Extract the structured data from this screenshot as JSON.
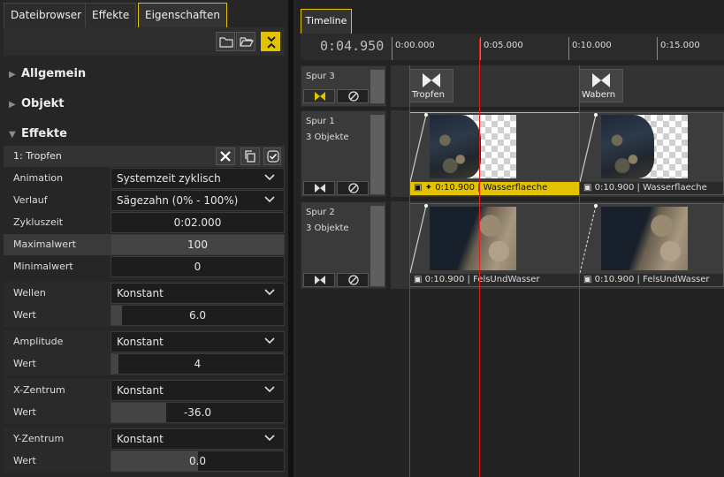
{
  "tabs": [
    {
      "label": "Dateibrowser",
      "active": false
    },
    {
      "label": "Effekte",
      "active": false
    },
    {
      "label": "Eigenschaften",
      "active": true
    }
  ],
  "toolbar_icons": [
    "folder-icon",
    "folder-open-icon",
    "collapse-icon"
  ],
  "sections": {
    "allgemein": "Allgemein",
    "objekt": "Objekt",
    "effekte": "Effekte"
  },
  "effect": {
    "title": "1: Tropfen",
    "rows": {
      "animation": {
        "label": "Animation",
        "value": "Systemzeit zyklisch"
      },
      "verlauf": {
        "label": "Verlauf",
        "value": "Sägezahn (0% - 100%)"
      },
      "zykluszeit": {
        "label": "Zykluszeit",
        "value": "0:02.000"
      },
      "maximalwert": {
        "label": "Maximalwert",
        "value": "100",
        "fill": 1.0
      },
      "minimalwert": {
        "label": "Minimalwert",
        "value": "0",
        "fill": 0.0
      }
    },
    "params": {
      "wellen": {
        "label": "Wellen",
        "mode": "Konstant",
        "wert_label": "Wert",
        "value": "6.0",
        "fill": 0.06
      },
      "amplitude": {
        "label": "Amplitude",
        "mode": "Konstant",
        "wert_label": "Wert",
        "value": "4",
        "fill": 0.04
      },
      "xzentrum": {
        "label": "X-Zentrum",
        "mode": "Konstant",
        "wert_label": "Wert",
        "value": "-36.0",
        "fill": 0.32
      },
      "yzentrum": {
        "label": "Y-Zentrum",
        "mode": "Konstant",
        "wert_label": "Wert",
        "value": "0.0",
        "fill": 0.5
      }
    }
  },
  "timeline": {
    "tab": "Timeline",
    "timecode": "0:04.950",
    "ticks": [
      "0:00.000",
      "0:05.000",
      "0:10.000",
      "0:15.000"
    ],
    "tracks": {
      "spur3": {
        "name": "Spur 3",
        "sub": ""
      },
      "spur1": {
        "name": "Spur 1",
        "sub": "3 Objekte"
      },
      "spur2": {
        "name": "Spur 2",
        "sub": "3 Objekte"
      }
    },
    "transitions": {
      "t1": "Tropfen",
      "t2": "Wabern"
    },
    "clips": {
      "c1": {
        "duration": "0:10.900",
        "name": "Wasserflaeche",
        "caption": "0:10.900 | Wasserflaeche"
      },
      "c2": {
        "caption": "0:10.900 | Wasserflaeche"
      },
      "c3": {
        "caption": "0:10.900 | FelsUndWasser"
      },
      "c4": {
        "caption": "0:10.900 | FelsUndWasser"
      }
    }
  },
  "colors": {
    "accent": "#e3c300",
    "playhead": "#e02020"
  }
}
